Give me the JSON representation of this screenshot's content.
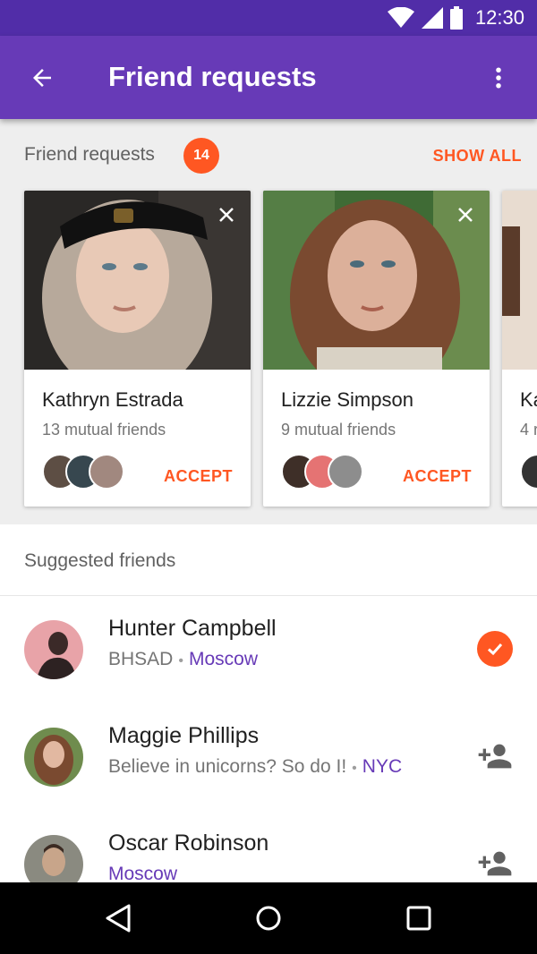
{
  "status_bar": {
    "time": "12:30"
  },
  "app_bar": {
    "title": "Friend requests"
  },
  "requests": {
    "title": "Friend requests",
    "count": "14",
    "show_all": "SHOW ALL",
    "cards": [
      {
        "name": "Kathryn Estrada",
        "mutual": "13 mutual friends",
        "accept": "ACCEPT"
      },
      {
        "name": "Lizzie Simpson",
        "mutual": "9 mutual friends",
        "accept": "ACCEPT"
      },
      {
        "name": "Ka",
        "mutual": "4 r"
      }
    ]
  },
  "suggested": {
    "title": "Suggested friends",
    "people": [
      {
        "name": "Hunter Campbell",
        "info": "BHSAD",
        "location": "Moscow"
      },
      {
        "name": "Maggie Phillips",
        "info": "Believe in unicorns? So do I!",
        "location": "NYC"
      },
      {
        "name": "Oscar Robinson",
        "location": "Moscow"
      }
    ]
  },
  "colors": {
    "primary": "#673ab7",
    "primary_dark": "#512da8",
    "accent": "#ff5722"
  }
}
